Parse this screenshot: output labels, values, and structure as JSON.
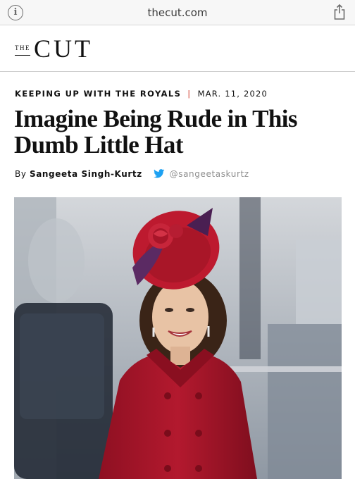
{
  "browser": {
    "url": "thecut.com",
    "info_icon": "info-icon",
    "share_icon": "share-icon"
  },
  "site": {
    "logo_small": "THE",
    "logo_large": "CUT"
  },
  "article": {
    "kicker": "KEEPING UP WITH THE ROYALS",
    "separator": "|",
    "date": "MAR. 11, 2020",
    "headline": "Imagine Being Rude in This Dumb Little Hat",
    "byline_prefix": "By",
    "author": "Sangeeta Singh-Kurtz",
    "twitter_handle": "@sangeetaskurtz",
    "twitter_icon": "twitter-bird-icon"
  },
  "colors": {
    "accent_separator": "#d03a2b",
    "twitter_blue": "#1da1f2",
    "coat_red": "#b3192e"
  }
}
